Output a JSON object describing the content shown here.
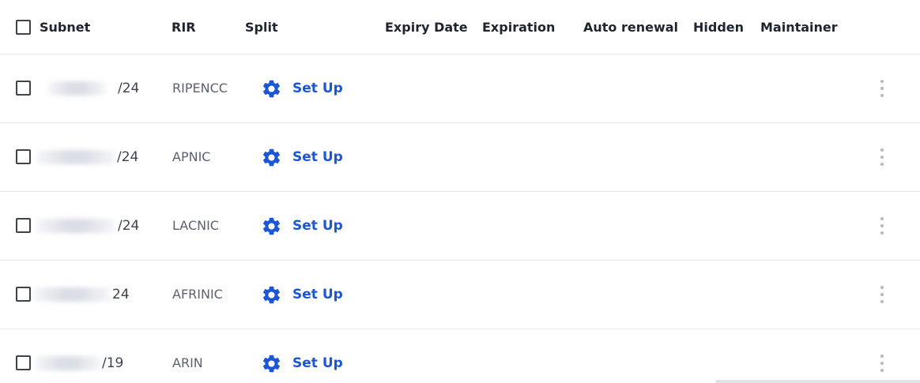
{
  "header": {
    "subnet": "Subnet",
    "rir": "RIR",
    "split": "Split",
    "expiry_date": "Expiry Date",
    "expiration": "Expiration",
    "auto_renewal": "Auto renewal",
    "hidden": "Hidden",
    "maintainer": "Maintainer"
  },
  "rows": [
    {
      "suffix": "/24",
      "rir": "RIPENCC",
      "action": "Set Up"
    },
    {
      "suffix": "/24",
      "rir": "APNIC",
      "action": "Set Up"
    },
    {
      "suffix": "/24",
      "rir": "LACNIC",
      "action": "Set Up"
    },
    {
      "suffix": "24",
      "rir": "AFRINIC",
      "action": "Set Up"
    },
    {
      "suffix": "/19",
      "rir": "ARIN",
      "action": "Set Up"
    }
  ],
  "colors": {
    "accent": "#1a56d6",
    "divider": "#e6e8ec",
    "muted": "#5b6170"
  },
  "icons": {
    "setup": "gear-icon",
    "row_menu": "more-vertical-icon"
  }
}
